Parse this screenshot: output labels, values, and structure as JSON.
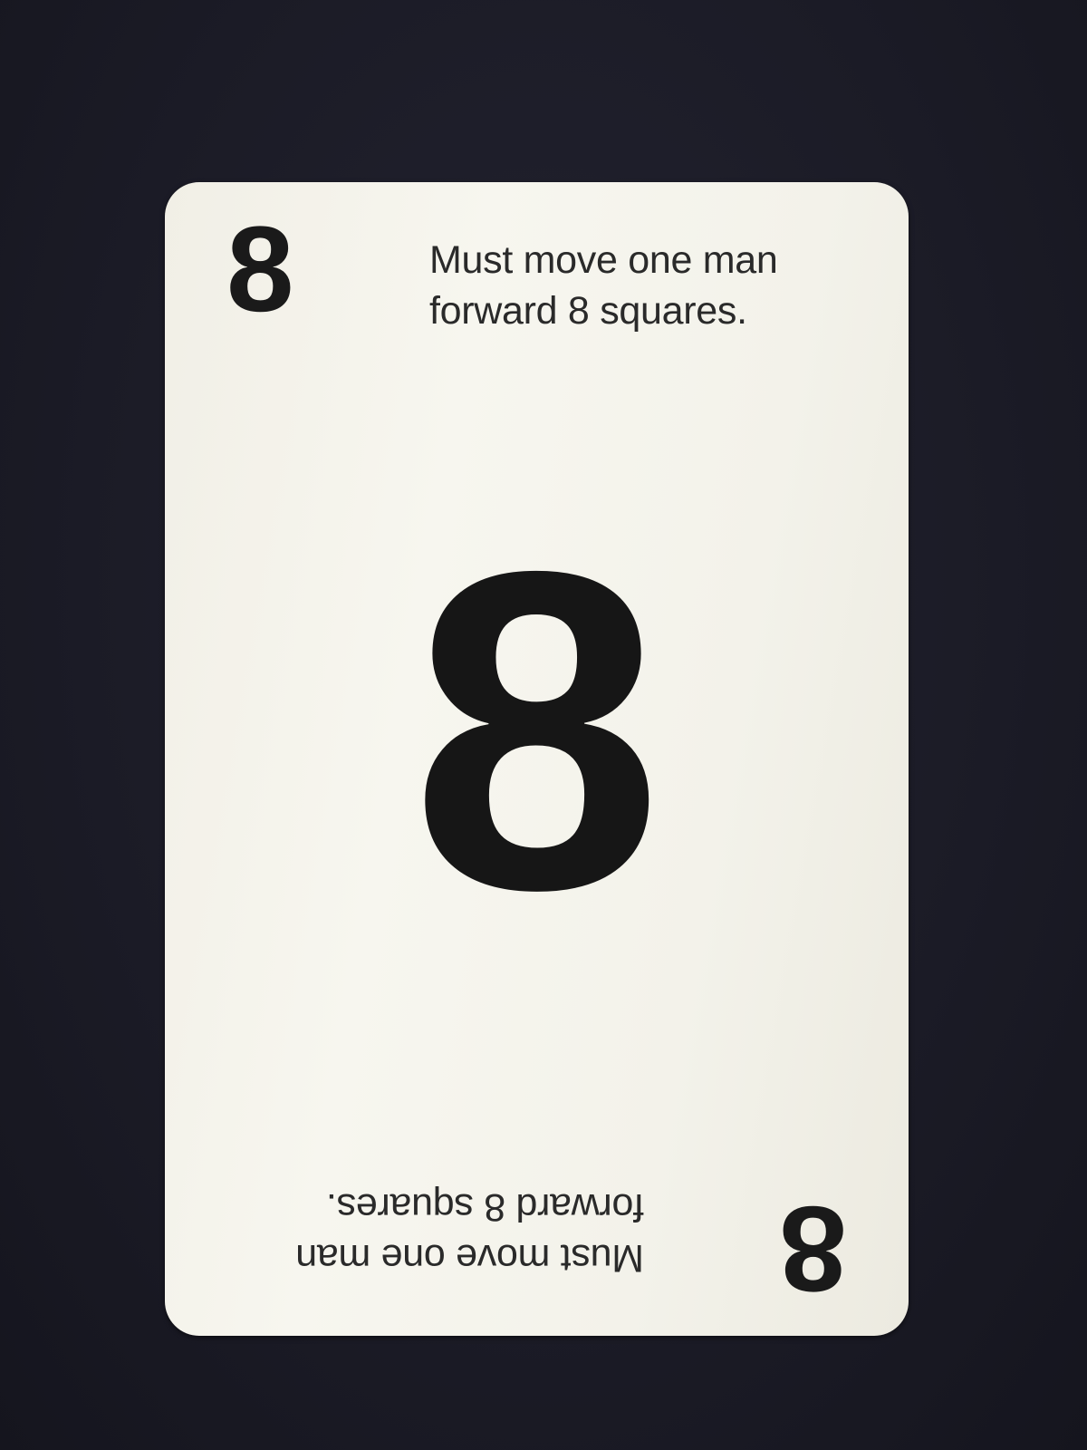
{
  "card": {
    "number": "8",
    "instruction_line1": "Must move one man",
    "instruction_line2": "forward 8 squares.",
    "colors": {
      "card": "#f4f2ea",
      "ink": "#1a1a1a",
      "background": "#1c1c28"
    }
  }
}
